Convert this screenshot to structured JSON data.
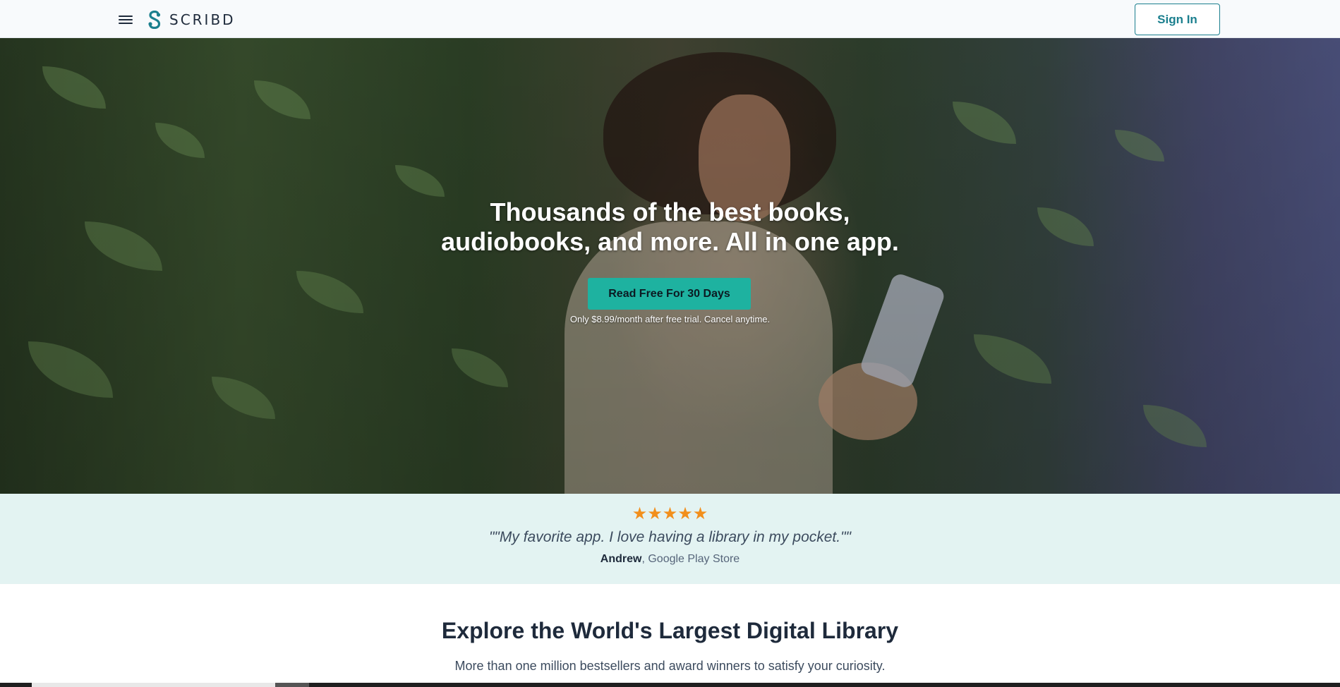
{
  "header": {
    "menu_icon": "hamburger-menu-icon",
    "logo_text": "SCRIBD",
    "signin_label": "Sign In"
  },
  "hero": {
    "title_line1": "Thousands of the best books,",
    "title_line2": "audiobooks, and more. All in one app.",
    "cta_label": "Read Free For 30 Days",
    "cta_note": "Only $8.99/month after free trial. Cancel anytime."
  },
  "testimonial": {
    "stars": "★★★★★",
    "quote": "\"\"My favorite app. I love having a library in my pocket.\"\"",
    "author": "Andrew",
    "source": ", Google Play Store"
  },
  "explore": {
    "title": "Explore the World's Largest Digital Library",
    "subtitle": "More than one million bestsellers and award winners to satisfy your curiosity."
  },
  "colors": {
    "brand_teal": "#1b7f8e",
    "cta_green": "#1eb2a0",
    "star_orange": "#f28f1c",
    "band_bg": "#e3f3f2"
  }
}
